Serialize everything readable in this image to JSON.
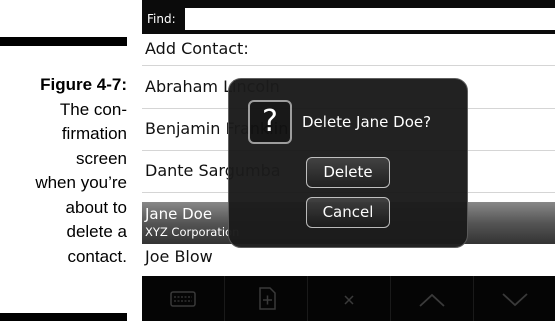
{
  "caption": {
    "figure": "Figure 4-7:",
    "lines": [
      "The con-",
      "firmation",
      "screen",
      "when you’re",
      "about to",
      "delete a",
      "contact."
    ]
  },
  "find": {
    "label": "Find:",
    "value": ""
  },
  "list": {
    "add_contact": "Add Contact:",
    "items": [
      "Abraham Lincoln",
      "Benjamin Franklin",
      "Dante Sargumba"
    ],
    "selected": {
      "name": "Jane Doe",
      "company": "XYZ Corporation"
    },
    "after": "Joe Blow"
  },
  "dialog": {
    "icon": "question-icon",
    "icon_glyph": "?",
    "message": "Delete Jane Doe?",
    "delete_label": "Delete",
    "cancel_label": "Cancel"
  },
  "toolbar": {
    "icons": [
      "keyboard-icon",
      "new-document-icon",
      "close-icon",
      "up-arrow-icon",
      "down-arrow-icon"
    ]
  }
}
